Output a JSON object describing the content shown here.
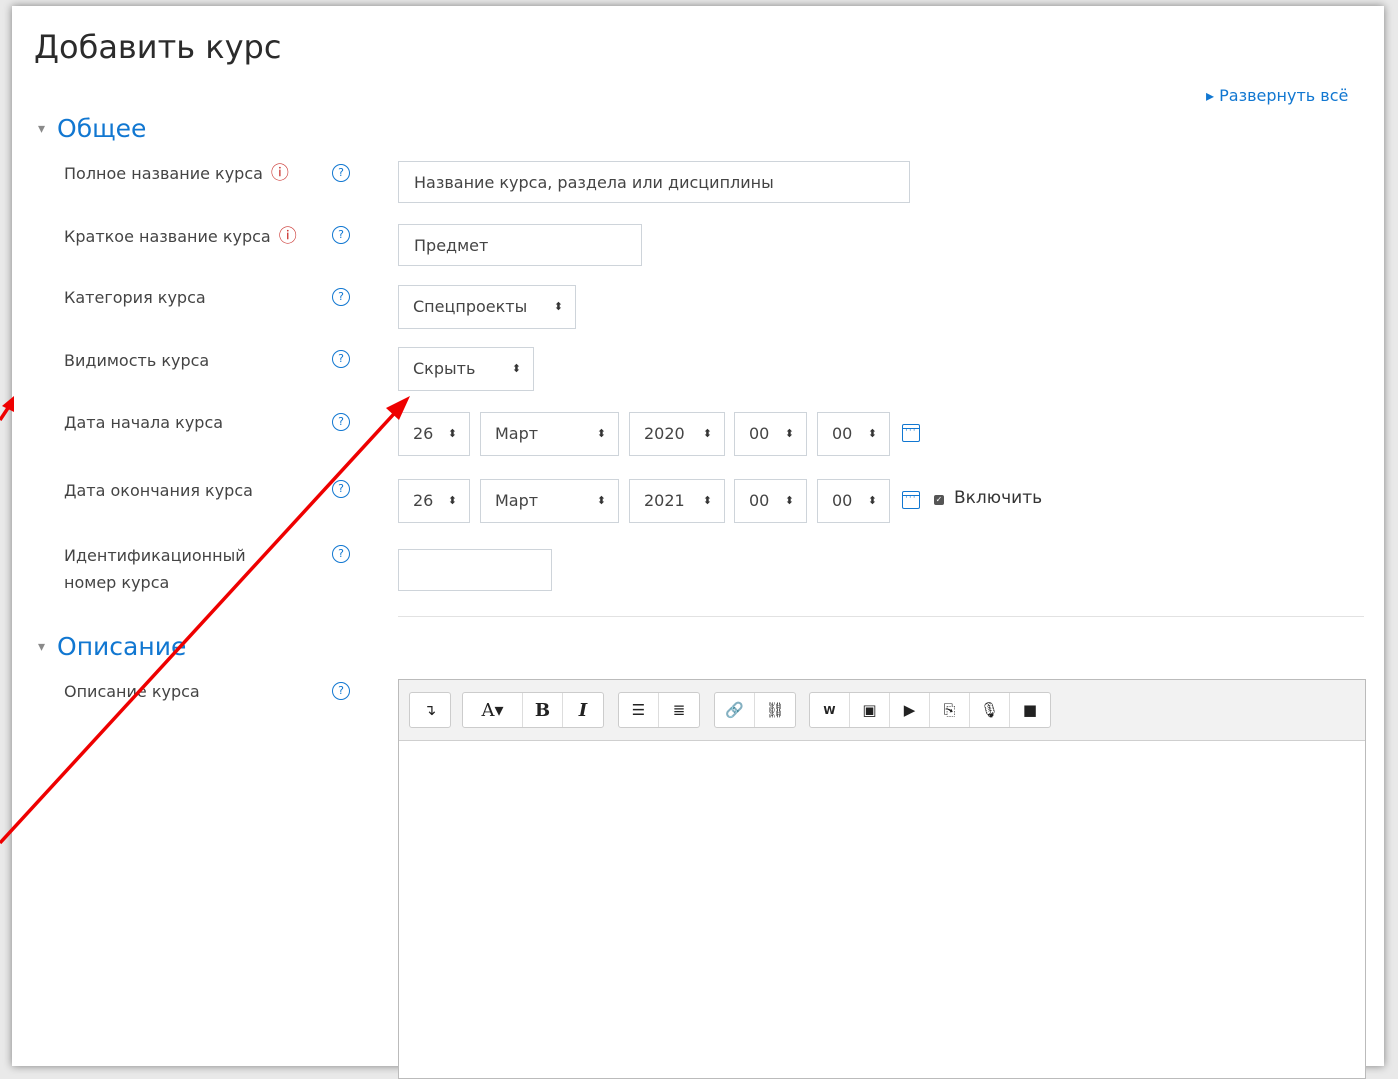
{
  "page": {
    "title": "Добавить курс",
    "expand_all": "▸ Развернуть всё"
  },
  "sections": {
    "general": {
      "title": "Общее",
      "toggle": "▾"
    },
    "description": {
      "title": "Описание",
      "toggle": "▾"
    }
  },
  "fields": {
    "fullname": {
      "label": "Полное название курса",
      "value": "Название курса, раздела или дисциплины",
      "required": "ⓘ"
    },
    "shortname": {
      "label": "Краткое название курса",
      "value": "Предмет",
      "required": "ⓘ"
    },
    "category": {
      "label": "Категория курса",
      "value": "Спецпроекты"
    },
    "visibility": {
      "label": "Видимость курса",
      "value": "Скрыть"
    },
    "startdate": {
      "label": "Дата начала курса",
      "day": "26",
      "month": "Март",
      "year": "2020",
      "hour": "00",
      "minute": "00"
    },
    "enddate": {
      "label": "Дата окончания курса",
      "day": "26",
      "month": "Март",
      "year": "2021",
      "hour": "00",
      "minute": "00",
      "enable_label": "Включить",
      "enable_checked": "✓"
    },
    "idnumber": {
      "label_line1": "Идентификационный",
      "label_line2": "номер курса",
      "value": ""
    },
    "summary": {
      "label": "Описание курса"
    }
  },
  "help_symbol": "?",
  "select_arrow": "⬍",
  "editor": {
    "toolbar": {
      "collapse": "↴",
      "font": "A▾",
      "bold": "B",
      "italic": "I",
      "ul": "☰",
      "ol": "≣",
      "link": "🔗",
      "unlink": "⛓",
      "word": "W",
      "image": "▣",
      "media": "▶",
      "manage": "⎘",
      "record_audio": "🎙",
      "record_video": "■"
    }
  },
  "colors": {
    "link": "#1177d1",
    "required": "#c9302c",
    "annotation_arrow": "#ee0000"
  }
}
